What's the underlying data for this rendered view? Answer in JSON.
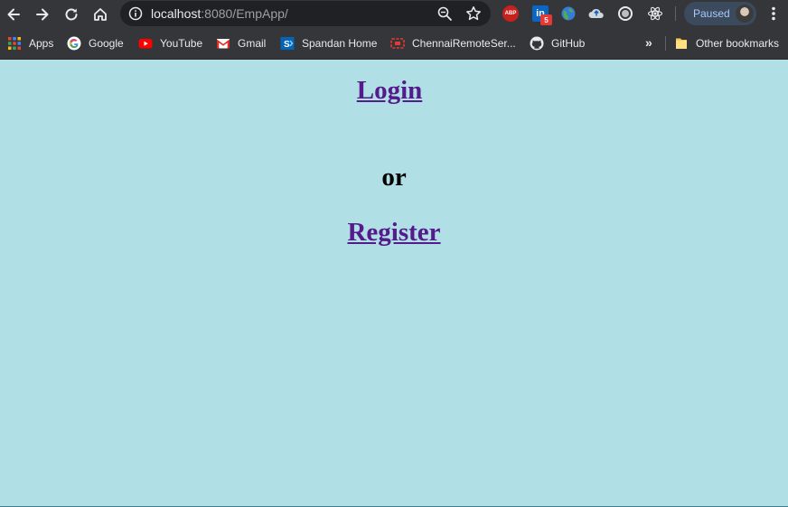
{
  "browser": {
    "url_host": "localhost",
    "url_rest": ":8080/EmpApp/",
    "profile_label": "Paused",
    "extensions": {
      "abp_label": "ABP",
      "linkedin_label": "in",
      "linkedin_badge": "5"
    }
  },
  "bookmarks": {
    "items": [
      {
        "label": "Apps",
        "icon": "apps-grid-icon"
      },
      {
        "label": "Google",
        "icon": "google-icon"
      },
      {
        "label": "YouTube",
        "icon": "youtube-icon"
      },
      {
        "label": "Gmail",
        "icon": "gmail-icon"
      },
      {
        "label": "Spandan Home",
        "icon": "sharepoint-icon"
      },
      {
        "label": "ChennaiRemoteSer...",
        "icon": "remote-server-icon"
      },
      {
        "label": "GitHub",
        "icon": "github-icon"
      }
    ],
    "more_label": "»",
    "other_label": "Other bookmarks"
  },
  "page": {
    "login_label": "Login",
    "or_label": "or",
    "register_label": "Register"
  },
  "colors": {
    "page_background": "#b0dfe5",
    "link": "#551a8b",
    "toolbar": "#35363a"
  }
}
